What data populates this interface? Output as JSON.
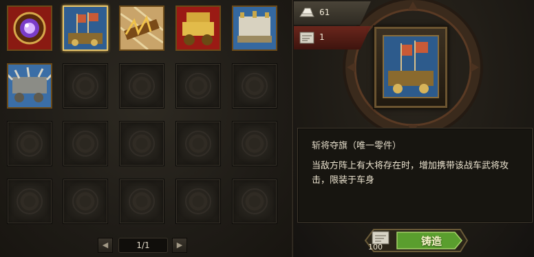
{
  "inventory": {
    "items": [
      {
        "name": "purple-orb"
      },
      {
        "name": "war-banner-cart"
      },
      {
        "name": "golden-spikes"
      },
      {
        "name": "golden-chariot"
      },
      {
        "name": "silver-fortress"
      },
      {
        "name": "spiked-war-wagon"
      }
    ],
    "empty_slots": 14,
    "pager": {
      "page": "1/1",
      "prev": "◀",
      "next": "▶"
    }
  },
  "resources": [
    {
      "icon": "silver-ingot-icon",
      "value": "61"
    },
    {
      "icon": "blueprint-scroll-icon",
      "value": "1"
    }
  ],
  "detail": {
    "title": "斩将夺旗（唯一零件）",
    "description": "当敌方阵上有大将存在时，增加携带该战车武将攻击，限装于车身"
  },
  "craft": {
    "cost": "100",
    "button_label": "铸造"
  },
  "colors": {
    "gold_border": "#e7c46a",
    "craft_green": "#6fb23b",
    "resource_plate": "#5a1f17"
  }
}
